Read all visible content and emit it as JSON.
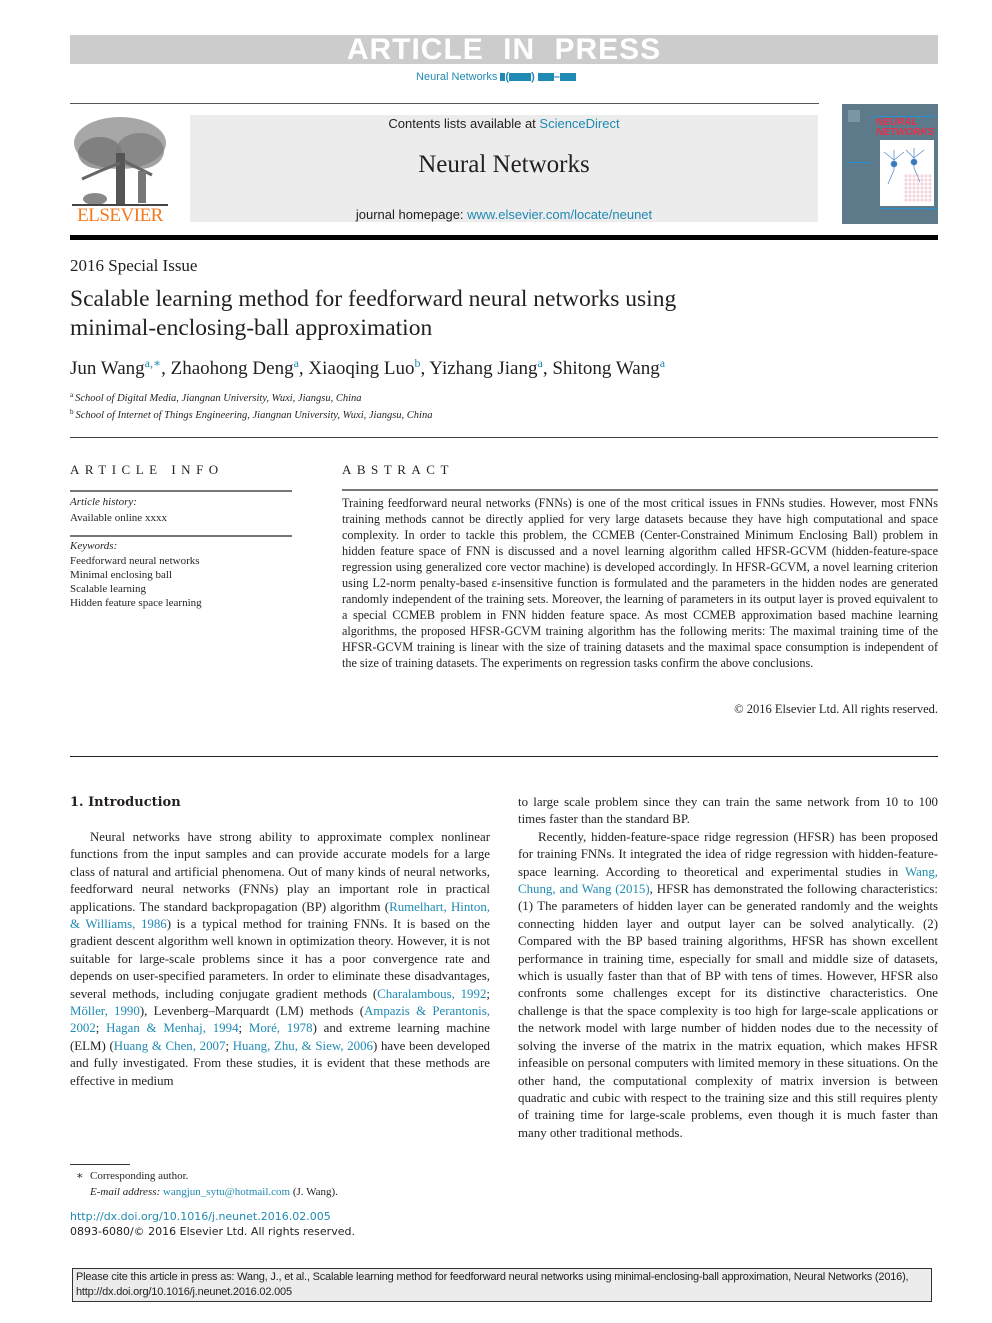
{
  "banner": {
    "text": "ARTICLE IN PRESS",
    "journal_ref": "Neural Networks"
  },
  "masthead": {
    "publisher_logo_text": "ELSEVIER",
    "contents_prefix": "Contents lists available at ",
    "contents_link": "ScienceDirect",
    "journal_title": "Neural Networks",
    "homepage_prefix": "journal homepage: ",
    "homepage_link": "www.elsevier.com/locate/neunet",
    "cover_title_line1": "NEURAL",
    "cover_title_line2": "NETWORKS"
  },
  "article": {
    "special_issue": "2016 Special Issue",
    "title_line1": "Scalable learning method for feedforward neural networks using",
    "title_line2": "minimal-enclosing-ball approximation",
    "authors": [
      {
        "name": "Jun Wang",
        "sup": "a,∗"
      },
      {
        "name": "Zhaohong Deng",
        "sup": "a"
      },
      {
        "name": "Xiaoqing Luo",
        "sup": "b"
      },
      {
        "name": "Yizhang Jiang",
        "sup": "a"
      },
      {
        "name": "Shitong Wang",
        "sup": "a"
      }
    ],
    "affiliations": [
      {
        "key": "a",
        "text": "School of Digital Media, Jiangnan University, Wuxi, Jiangsu, China"
      },
      {
        "key": "b",
        "text": "School of Internet of Things Engineering, Jiangnan University, Wuxi, Jiangsu, China"
      }
    ]
  },
  "article_info": {
    "heading": "ARTICLE INFO",
    "history_label": "Article history:",
    "history_value": "Available online xxxx",
    "keywords_label": "Keywords:",
    "keywords": [
      "Feedforward neural networks",
      "Minimal enclosing ball",
      "Scalable learning",
      "Hidden feature space learning"
    ]
  },
  "abstract": {
    "heading": "ABSTRACT",
    "text": "Training feedforward neural networks (FNNs) is one of the most critical issues in FNNs studies. However, most FNNs training methods cannot be directly applied for very large datasets because they have high computational and space complexity. In order to tackle this problem, the CCMEB (Center-Constrained Minimum Enclosing Ball) problem in hidden feature space of FNN is discussed and a novel learning algorithm called HFSR-GCVM (hidden-feature-space regression using generalized core vector machine) is developed accordingly. In HFSR-GCVM, a novel learning criterion using L2-norm penalty-based ε-insensitive function is formulated and the parameters in the hidden nodes are generated randomly independent of the training sets. Moreover, the learning of parameters in its output layer is proved equivalent to a special CCMEB problem in FNN hidden feature space. As most CCMEB approximation based machine learning algorithms, the proposed HFSR-GCVM training algorithm has the following merits: The maximal training time of the HFSR-GCVM training is linear with the size of training datasets and the maximal space consumption is independent of the size of training datasets. The experiments on regression tasks confirm the above conclusions.",
    "copyright": "© 2016 Elsevier Ltd. All rights reserved."
  },
  "body": {
    "section_heading": "1.  Introduction",
    "left_col": {
      "p1_a": "Neural networks have strong ability to approximate complex nonlinear functions from the input samples and can provide accurate models for a large class of natural and artificial phenomena. Out of many kinds of neural networks, feedforward neural networks (FNNs) play an important role in practical applications. The standard backpropagation (BP) algorithm (",
      "cite_rumelhart": "Rumelhart, Hinton, & Williams, 1986",
      "p1_b": ") is a typical method for training FNNs. It is based on the gradient descent algorithm well known in optimization theory. However, it is not suitable for large-scale problems since it has a poor convergence rate and depends on user-specified parameters. In order to eliminate these disadvantages, several methods, including conjugate gradient methods (",
      "cite_charalambous": "Charalambous, 1992",
      "sep1": "; ",
      "cite_moller": "Möller, 1990",
      "p1_c": "), Levenberg–Marquardt (LM) methods (",
      "cite_ampazis": "Ampazis & Perantonis, 2002",
      "sep2": "; ",
      "cite_hagan": "Hagan & Menhaj, 1994",
      "sep3": "; ",
      "cite_more": "Moré, 1978",
      "p1_d": ") and extreme learning machine (ELM) (",
      "cite_huang_chen": "Huang & Chen, 2007",
      "sep4": "; ",
      "cite_huang_zhu": "Huang, Zhu, & Siew, 2006",
      "p1_e": ") have been developed and fully investigated. From these studies, it is evident that these methods are effective in medium"
    },
    "right_col": {
      "p1_cont": "to large scale problem since they can train the same network from 10 to 100 times faster than the standard BP.",
      "p2_a": "Recently, hidden-feature-space ridge regression (HFSR) has been proposed for training FNNs. It integrated the idea of ridge regression with hidden-feature-space learning. According to theoretical and experimental studies in ",
      "cite_wang": "Wang, Chung, and Wang (2015)",
      "p2_b": ", HFSR has demonstrated the following characteristics: (1) The parameters of hidden layer can be generated randomly and the weights connecting hidden layer and output layer can be solved analytically. (2) Compared with the BP based training algorithms, HFSR has shown excellent performance in training time, especially for small and middle size of datasets, which is usually faster than that of BP with tens of times. However, HFSR also confronts some challenges except for its distinctive characteristics. One challenge is that the space complexity is too high for large-scale applications or the network model with large number of hidden nodes due to the necessity of solving the inverse of the matrix in the matrix equation, which makes HFSR infeasible on personal computers with limited memory in these situations. On the other hand, the computational complexity of matrix inversion is between quadratic and cubic with respect to the training size and this still requires plenty of training time for large-scale problems, even though it is much faster than many other traditional methods."
    }
  },
  "footnotes": {
    "star": "∗",
    "corresponding": "Corresponding author.",
    "email_label": "E-mail address: ",
    "email": "wangjun_sytu@hotmail.com",
    "email_suffix": " (J. Wang).",
    "doi": "http://dx.doi.org/10.1016/j.neunet.2016.02.005",
    "issn": "0893-6080/© 2016 Elsevier Ltd. All rights reserved."
  },
  "cite_box": {
    "text": "Please cite this article in press as: Wang, J., et al., Scalable learning method for feedforward neural networks using minimal-enclosing-ball approximation, Neural Networks (2016), http://dx.doi.org/10.1016/j.neunet.2016.02.005"
  },
  "colors": {
    "link": "#1f8ab3",
    "publisher_orange": "#f47920",
    "banner_gray": "#cccccc"
  }
}
